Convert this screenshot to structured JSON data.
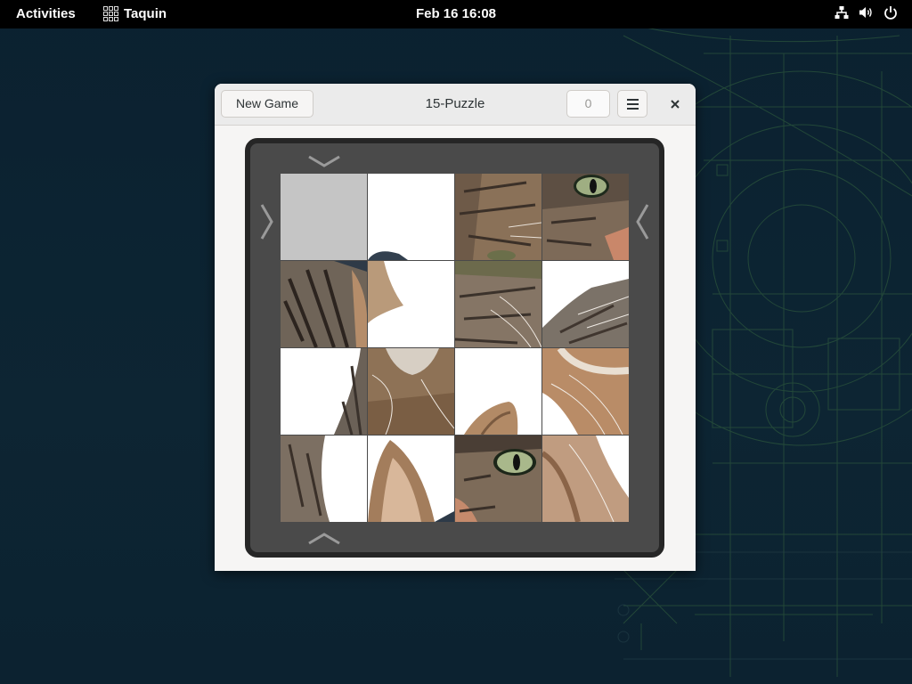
{
  "topbar": {
    "activities": "Activities",
    "app_name": "Taquin",
    "clock": "Feb 16  16:08",
    "tray_icons": [
      "network-icon",
      "volume-icon",
      "power-icon"
    ]
  },
  "window": {
    "new_game_label": "New Game",
    "title": "15-Puzzle",
    "move_counter": "0",
    "menu_icon": "hamburger-menu-icon",
    "close_icon": "close-icon"
  },
  "board": {
    "size": "4x4",
    "empty_tile": [
      0,
      0
    ],
    "arrows": [
      "chevron-down-icon",
      "chevron-up-icon",
      "chevron-right-icon",
      "chevron-left-icon"
    ],
    "image_subject": "tabby cat face"
  },
  "colors": {
    "topbar": "#000000",
    "wallpaper": "#0d2230",
    "window_bg": "#f6f5f4",
    "frame_border": "#262626",
    "frame_bg": "#4a4a4a",
    "empty_tile": "#c5c5c5"
  }
}
